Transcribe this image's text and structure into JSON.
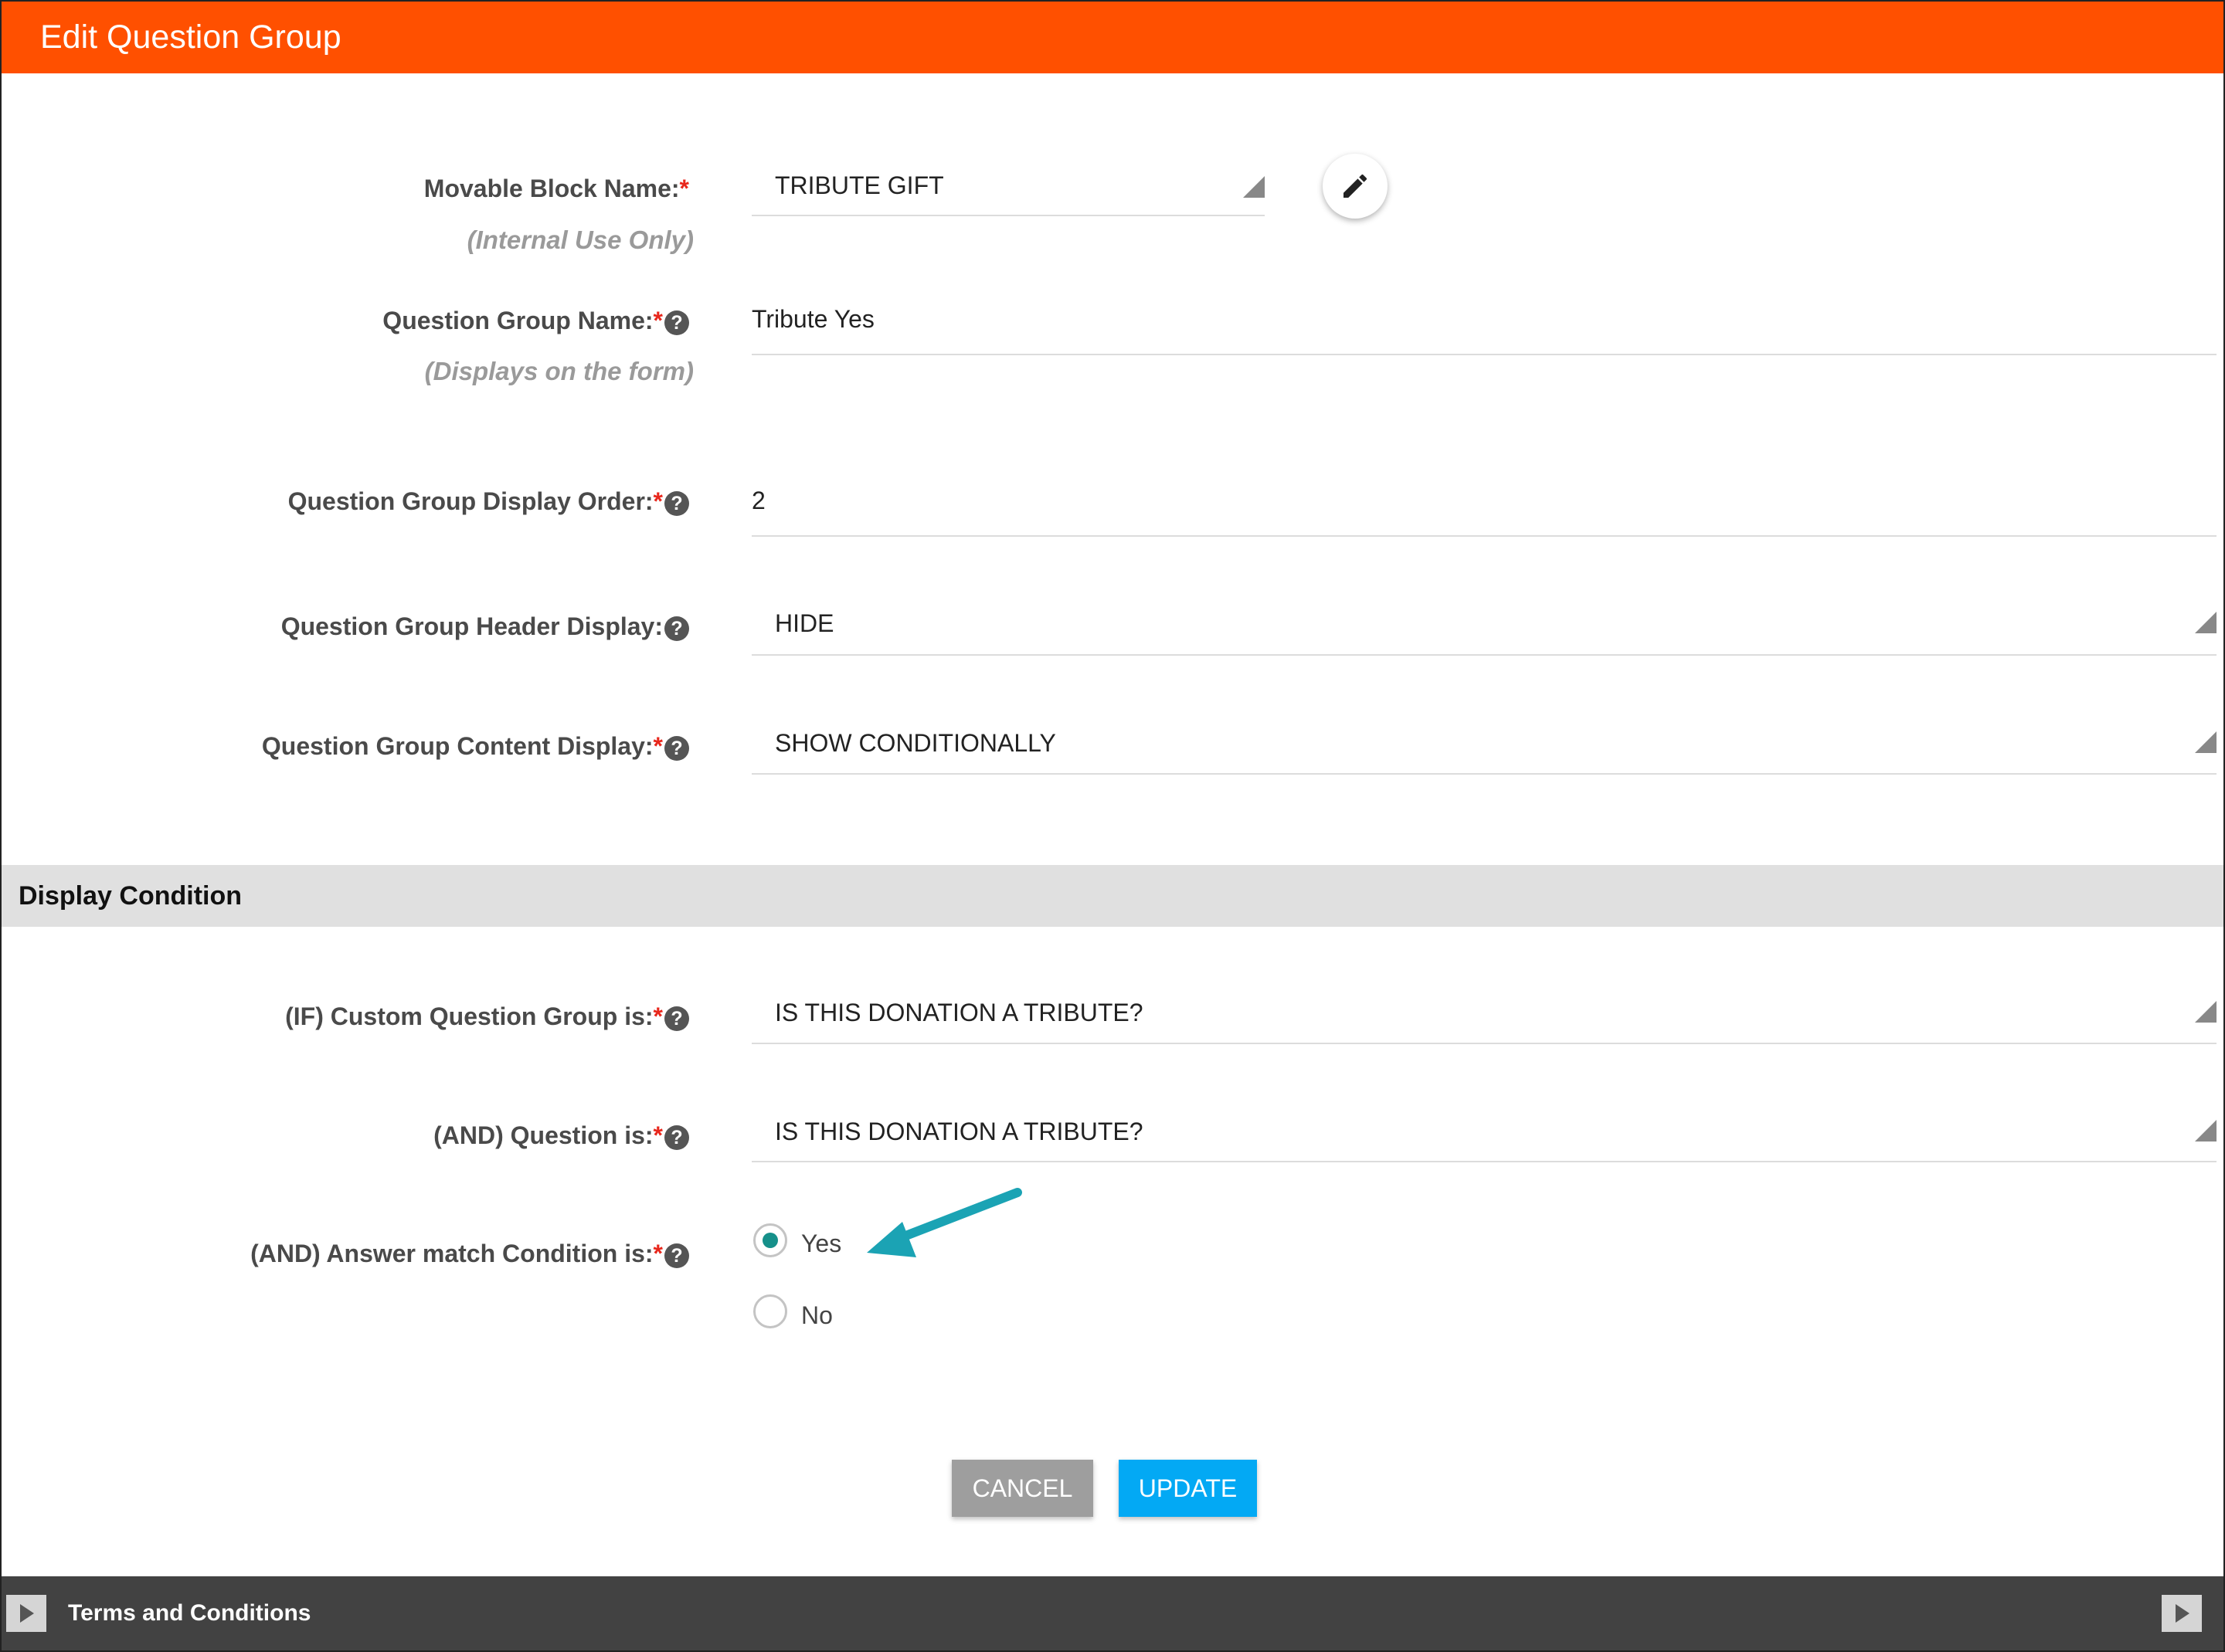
{
  "dialog": {
    "title": "Edit Question Group"
  },
  "colors": {
    "header": "#ff5000",
    "accent_radio": "#16908a",
    "update_button": "#03a9f4",
    "cancel_button": "#9e9e9e",
    "required": "#e8271c",
    "arrow": "#1ba3b4"
  },
  "form": {
    "movable_block": {
      "label": "Movable Block Name:",
      "required": "*",
      "sublabel": "(Internal Use Only)",
      "value": "TRIBUTE GIFT"
    },
    "group_name": {
      "label": "Question Group Name:",
      "required": "*",
      "help": "?",
      "sublabel": "(Displays on the form)",
      "value": "Tribute Yes"
    },
    "display_order": {
      "label": "Question Group Display Order:",
      "required": "*",
      "help": "?",
      "value": "2"
    },
    "header_display": {
      "label": "Question Group Header Display:",
      "help": "?",
      "value": "HIDE"
    },
    "content_display": {
      "label": "Question Group Content Display:",
      "required": "*",
      "help": "?",
      "value": "SHOW CONDITIONALLY"
    }
  },
  "condition": {
    "section_title": "Display Condition",
    "custom_group": {
      "label": "(IF) Custom Question Group is:",
      "required": "*",
      "help": "?",
      "value": "IS THIS DONATION A TRIBUTE?"
    },
    "question": {
      "label": "(AND) Question is:",
      "required": "*",
      "help": "?",
      "value": "IS THIS DONATION A TRIBUTE?"
    },
    "answer": {
      "label": "(AND) Answer match Condition is:",
      "required": "*",
      "help": "?",
      "options": [
        "Yes",
        "No"
      ],
      "selected": "Yes"
    }
  },
  "buttons": {
    "cancel": "CANCEL",
    "update": "UPDATE"
  },
  "footer": {
    "text": "Terms and Conditions"
  },
  "icons": {
    "edit": "pencil-icon",
    "help": "question-circle-icon",
    "expand": "play-icon",
    "annotation": "arrow-icon"
  }
}
